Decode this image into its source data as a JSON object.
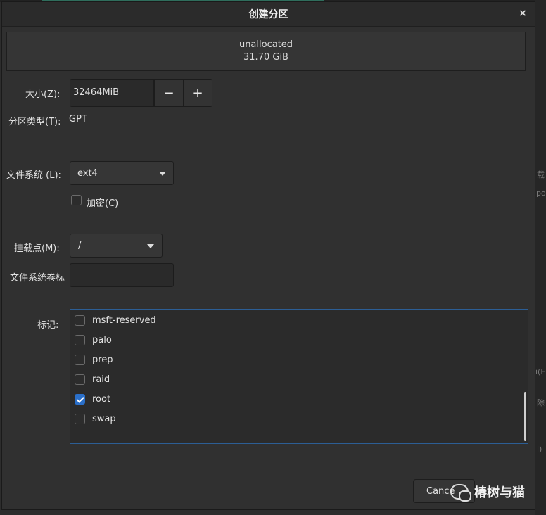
{
  "dialog": {
    "title": "创建分区",
    "close_glyph": "×"
  },
  "partition": {
    "name": "unallocated",
    "size": "31.70 GiB"
  },
  "size_field": {
    "label": "大小(Z):",
    "value": "32464MiB",
    "minus": "−",
    "plus": "+"
  },
  "partition_type": {
    "label": "分区类型(T):",
    "value": "GPT"
  },
  "filesystem": {
    "label": "文件系统 (L):",
    "value": "ext4"
  },
  "encrypt": {
    "label": "加密(C)",
    "checked": false
  },
  "mount_point": {
    "label": "挂载点(M):",
    "value": "/"
  },
  "fs_label": {
    "label": "文件系统卷标",
    "value": ""
  },
  "flags": {
    "label": "标记:",
    "items": [
      {
        "name": "msft-reserved",
        "checked": false
      },
      {
        "name": "palo",
        "checked": false
      },
      {
        "name": "prep",
        "checked": false
      },
      {
        "name": "raid",
        "checked": false
      },
      {
        "name": "root",
        "checked": true
      },
      {
        "name": "swap",
        "checked": false
      }
    ]
  },
  "buttons": {
    "cancel": "Cance"
  },
  "right_pane": {
    "t1": "载",
    "t2": "po",
    "t3": "i(E",
    "t4": "除",
    "t5": "l)"
  },
  "watermark": {
    "text": "椿树与猫"
  },
  "colors": {
    "accent": "#2a6fc9",
    "selection_border": "#2c5e95",
    "background": "#303030"
  }
}
